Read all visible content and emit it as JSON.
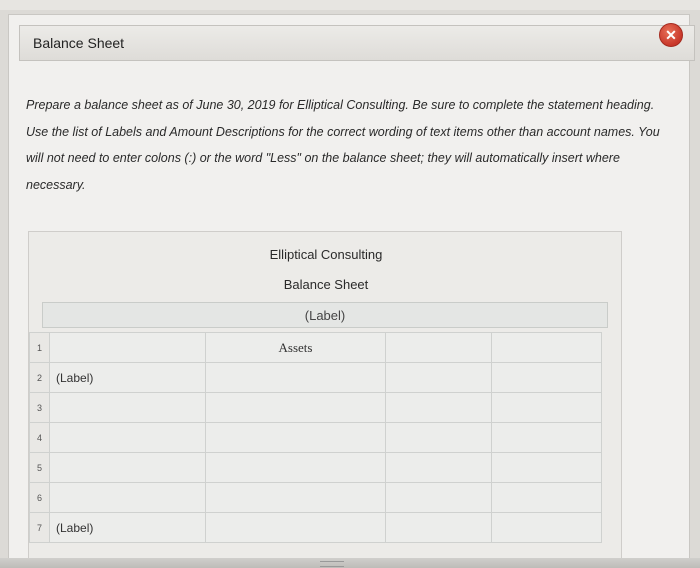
{
  "dialog": {
    "title": "Balance Sheet",
    "close_icon": "close-x-icon",
    "close_color": "#d0412f"
  },
  "instructions": "Prepare a balance sheet as of June 30, 2019 for Elliptical Consulting. Be sure to complete the statement heading. Use the list of Labels and Amount Descriptions for the correct wording of text items other than account names. You will not need to enter colons (:) or the word \"Less\" on the balance sheet; they will automatically insert where necessary.",
  "statement": {
    "company": "Elliptical Consulting",
    "statement_name": "Balance Sheet",
    "date_label": "(Label)",
    "rows": [
      {
        "num": "1",
        "text": "",
        "header": "Assets"
      },
      {
        "num": "2",
        "text": "(Label)",
        "header": ""
      },
      {
        "num": "3",
        "text": "",
        "header": ""
      },
      {
        "num": "4",
        "text": "",
        "header": ""
      },
      {
        "num": "5",
        "text": "",
        "header": ""
      },
      {
        "num": "6",
        "text": "",
        "header": ""
      },
      {
        "num": "7",
        "text": "(Label)",
        "header": ""
      }
    ]
  }
}
